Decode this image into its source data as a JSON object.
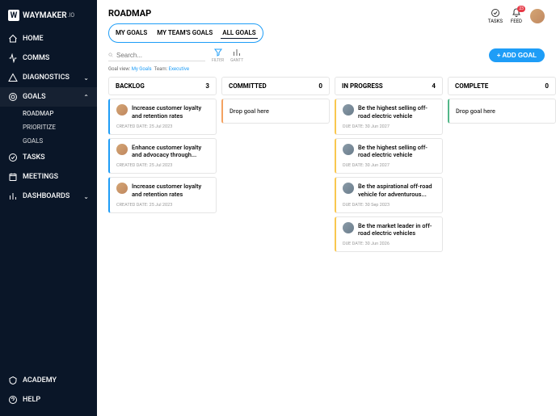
{
  "brand": {
    "name": "WAYMAKER",
    "suffix": ".IO"
  },
  "nav": {
    "home": "HOME",
    "comms": "COMMS",
    "diagnostics": "DIAGNOSTICS",
    "goals": "GOALS",
    "roadmap": "ROADMAP",
    "prioritize": "PRIORITIZE",
    "goals_sub": "GOALS",
    "tasks": "TASKS",
    "meetings": "MEETINGS",
    "dashboards": "DASHBOARDS",
    "academy": "ACADEMY",
    "help": "HELP"
  },
  "page": {
    "title": "ROADMAP"
  },
  "tabs": {
    "my": "MY GOALS",
    "team": "MY TEAM'S GOALS",
    "all": "ALL GOALS"
  },
  "header_icons": {
    "tasks": "TASKS",
    "feed": "FEED",
    "feed_badge": "23"
  },
  "search": {
    "placeholder": "Search..."
  },
  "tools": {
    "filter": "FILTER",
    "gantt": "GANTT"
  },
  "add_goal": "+  ADD GOAL",
  "meta": {
    "goalview_label": "Goal view:",
    "goalview_val": "My Goals",
    "team_label": "Team:",
    "team_val": "Executive"
  },
  "columns": {
    "backlog": {
      "title": "BACKLOG",
      "count": "3"
    },
    "committed": {
      "title": "COMMITTED",
      "count": "0"
    },
    "progress": {
      "title": "IN PROGRESS",
      "count": "4"
    },
    "complete": {
      "title": "COMPLETE",
      "count": "0"
    }
  },
  "drop": "Drop goal here",
  "cards": {
    "b1": {
      "title": "Increase customer loyalty and retention rates",
      "meta": "CREATED DATE: 25 Jul 2023"
    },
    "b2": {
      "title": "Enhance customer loyalty and advocacy through...",
      "meta": "CREATED DATE: 25 Jul 2023"
    },
    "b3": {
      "title": "Increase customer loyalty and retention rates",
      "meta": "CREATED DATE: 25 Jul 2023"
    },
    "p1": {
      "title": "Be the highest selling off-road electric vehicle",
      "meta": "DUE DATE: 30 Jun 2027"
    },
    "p2": {
      "title": "Be the highest selling off-road electric vehicle",
      "meta": "DUE DATE: 30 Jun 2027"
    },
    "p3": {
      "title": "Be the aspirational off-road vehicle for adventurous...",
      "meta": "DUE DATE: 30 Sep 2023"
    },
    "p4": {
      "title": "Be the market leader in off-road electric vehicles",
      "meta": "DUE DATE: 30 Jun 2026"
    }
  }
}
